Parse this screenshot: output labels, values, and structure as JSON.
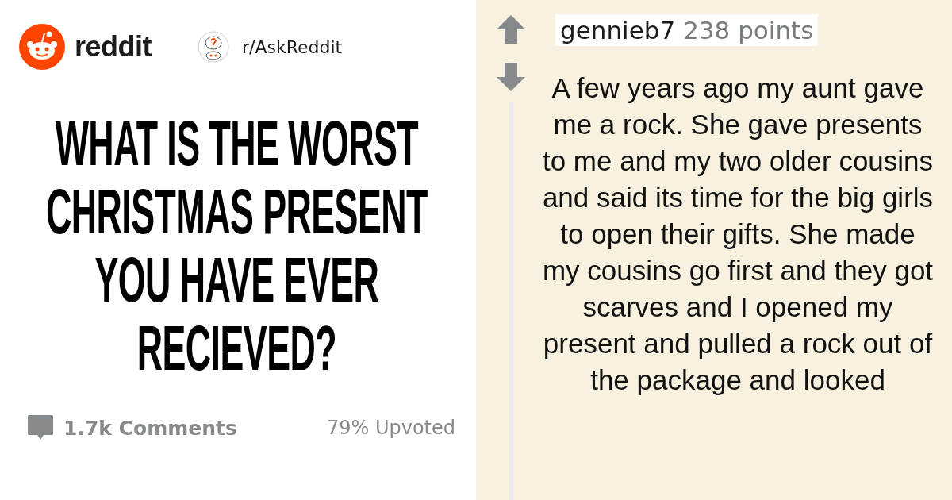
{
  "post": {
    "site": "reddit",
    "subreddit": "r/AskReddit",
    "title": "WHAT IS THE WORST CHRISTMAS PRESENT YOU HAVE EVER RECIEVED?",
    "comments": "1.7k Comments",
    "upvoted": "79% Upvoted"
  },
  "comment": {
    "author": "gennieb7",
    "points": "238 points",
    "text": "A few years ago my aunt gave me a rock. She gave presents to me and my two older cousins and said its time for the big girls to open their gifts. She made my cousins go first and they got scarves and I opened my present and pulled a rock out of the package and looked"
  }
}
